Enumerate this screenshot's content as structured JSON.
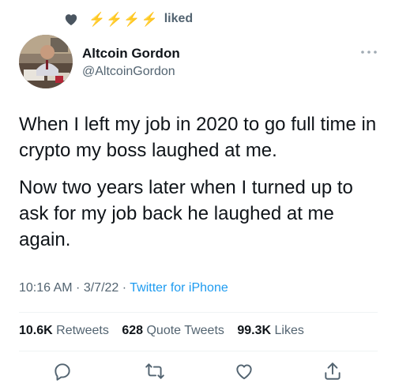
{
  "liked_bar": {
    "icons": [
      "heart-icon",
      "lightning-bolt-icon",
      "lightning-bolt-icon",
      "lightning-bolt-icon",
      "lightning-bolt-icon"
    ],
    "label": "liked"
  },
  "author": {
    "name": "Altcoin Gordon",
    "handle": "@AltcoinGordon"
  },
  "tweet": {
    "paragraph_1": "When I left my job in 2020 to go full time in crypto my boss laughed at me.",
    "paragraph_2": "Now two years later when I turned up to ask for my job back he laughed at me again."
  },
  "meta": {
    "time": "10:16 AM",
    "sep1": " · ",
    "date": "3/7/22",
    "sep2": " · ",
    "source": "Twitter for iPhone"
  },
  "stats": {
    "retweets_count": "10.6K",
    "retweets_label": "Retweets",
    "quotes_count": "628",
    "quotes_label": "Quote Tweets",
    "likes_count": "99.3K",
    "likes_label": "Likes"
  },
  "actions": [
    "reply-icon",
    "retweet-icon",
    "like-icon",
    "share-icon"
  ],
  "colors": {
    "text": "#0f1419",
    "secondary": "#536471",
    "link": "#1d9bf0",
    "divider": "#eff3f4",
    "bolt": "#f4b400"
  }
}
